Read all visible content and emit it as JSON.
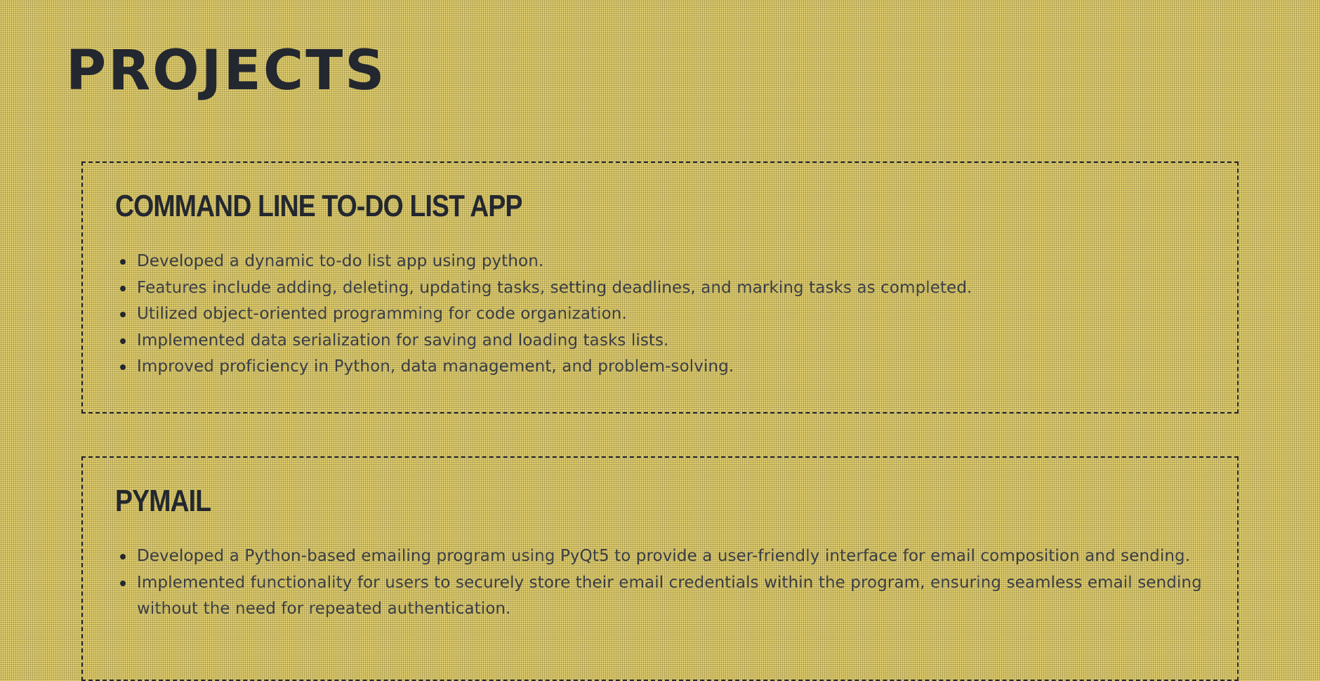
{
  "page": {
    "title": "Projects"
  },
  "projects": [
    {
      "title": "Command Line To-Do List App",
      "bullets": [
        "Developed a dynamic to-do list app using python.",
        "Features include adding, deleting, updating tasks, setting deadlines, and marking tasks as completed.",
        "Utilized object-oriented programming for code organization.",
        "Implemented data serialization for saving and loading tasks lists.",
        "Improved proficiency in Python, data management, and problem-solving."
      ]
    },
    {
      "title": "PyMail",
      "bullets": [
        "Developed a Python-based emailing program using PyQt5 to provide a user-friendly interface for email composition and sending.",
        "Implemented functionality for users to securely store their email credentials within the program, ensuring seamless email sending without the need for repeated authentication."
      ]
    }
  ],
  "colors": {
    "background": "#e4d06e",
    "text": "#23272f",
    "body_text": "#3a3e45"
  }
}
